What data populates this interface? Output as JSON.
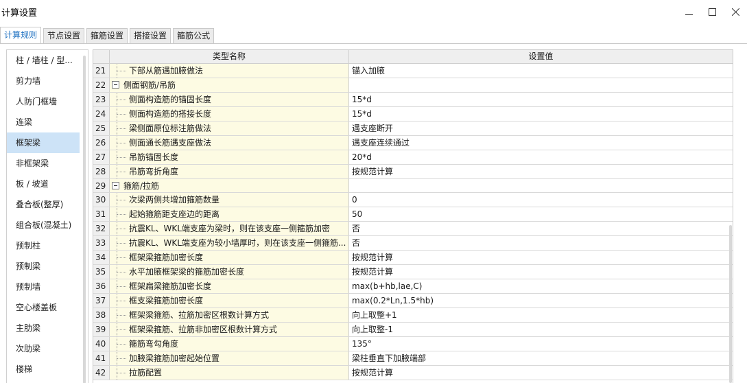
{
  "window": {
    "title": "计算设置",
    "controls": [
      "minimize",
      "maximize",
      "close"
    ]
  },
  "tabs": [
    {
      "label": "计算规则",
      "active": true
    },
    {
      "label": "节点设置",
      "active": false
    },
    {
      "label": "箍筋设置",
      "active": false
    },
    {
      "label": "搭接设置",
      "active": false
    },
    {
      "label": "箍筋公式",
      "active": false
    }
  ],
  "sidebar": {
    "items": [
      {
        "label": "柱 / 墙柱 / 型..."
      },
      {
        "label": "剪力墙"
      },
      {
        "label": "人防门框墙"
      },
      {
        "label": "连梁"
      },
      {
        "label": "框架梁",
        "selected": true
      },
      {
        "label": "非框架梁"
      },
      {
        "label": "板 / 坡道"
      },
      {
        "label": "叠合板(整厚)"
      },
      {
        "label": "组合板(混凝土)"
      },
      {
        "label": "预制柱"
      },
      {
        "label": "预制梁"
      },
      {
        "label": "预制墙"
      },
      {
        "label": "空心楼盖板"
      },
      {
        "label": "主肋梁"
      },
      {
        "label": "次肋梁"
      },
      {
        "label": "楼梯"
      }
    ]
  },
  "grid": {
    "headers": {
      "name": "类型名称",
      "value": "设置值"
    },
    "rows": [
      {
        "num": "21",
        "name": "下部从筋遇加腋做法",
        "value": "锚入加腋",
        "group": false
      },
      {
        "num": "22",
        "name": "侧面钢筋/吊筋",
        "value": "",
        "group": true
      },
      {
        "num": "23",
        "name": "侧面构造筋的锚固长度",
        "value": "15*d",
        "group": false
      },
      {
        "num": "24",
        "name": "侧面构造筋的搭接长度",
        "value": "15*d",
        "group": false
      },
      {
        "num": "25",
        "name": "梁侧面原位标注筋做法",
        "value": "遇支座断开",
        "group": false
      },
      {
        "num": "26",
        "name": "侧面通长筋遇支座做法",
        "value": "遇支座连续通过",
        "group": false
      },
      {
        "num": "27",
        "name": "吊筋锚固长度",
        "value": "20*d",
        "group": false
      },
      {
        "num": "28",
        "name": "吊筋弯折角度",
        "value": "按规范计算",
        "group": false
      },
      {
        "num": "29",
        "name": "箍筋/拉筋",
        "value": "",
        "group": true
      },
      {
        "num": "30",
        "name": "次梁两侧共增加箍筋数量",
        "value": "0",
        "group": false
      },
      {
        "num": "31",
        "name": "起始箍筋距支座边的距离",
        "value": "50",
        "group": false
      },
      {
        "num": "32",
        "name": "抗震KL、WKL端支座为梁时，则在该支座一侧箍筋加密",
        "value": "否",
        "group": false
      },
      {
        "num": "33",
        "name": "抗震KL、WKL端支座为较小墙厚时，则在该支座一侧箍筋...",
        "value": "否",
        "group": false
      },
      {
        "num": "34",
        "name": "框架梁箍筋加密长度",
        "value": "按规范计算",
        "group": false
      },
      {
        "num": "35",
        "name": "水平加腋框架梁的箍筋加密长度",
        "value": "按规范计算",
        "group": false
      },
      {
        "num": "36",
        "name": "框架扁梁箍筋加密长度",
        "value": "max(b+hb,lae,C)",
        "group": false
      },
      {
        "num": "37",
        "name": "框支梁箍筋加密长度",
        "value": "max(0.2*Ln,1.5*hb)",
        "group": false
      },
      {
        "num": "38",
        "name": "框架梁箍筋、拉筋加密区根数计算方式",
        "value": "向上取整+1",
        "group": false
      },
      {
        "num": "39",
        "name": "框架梁箍筋、拉筋非加密区根数计算方式",
        "value": "向上取整-1",
        "group": false
      },
      {
        "num": "40",
        "name": "箍筋弯勾角度",
        "value": "135°",
        "group": false
      },
      {
        "num": "41",
        "name": "加腋梁箍筋加密起始位置",
        "value": "梁柱垂直下加腋端部",
        "group": false
      },
      {
        "num": "42",
        "name": "拉筋配置",
        "value": "按规范计算",
        "group": false
      }
    ]
  },
  "colors": {
    "accent": "#1b6fc0",
    "selected_bg": "#cde3f7",
    "name_cell_bg": "#fdfbe3",
    "header_bg": "#efefef"
  }
}
